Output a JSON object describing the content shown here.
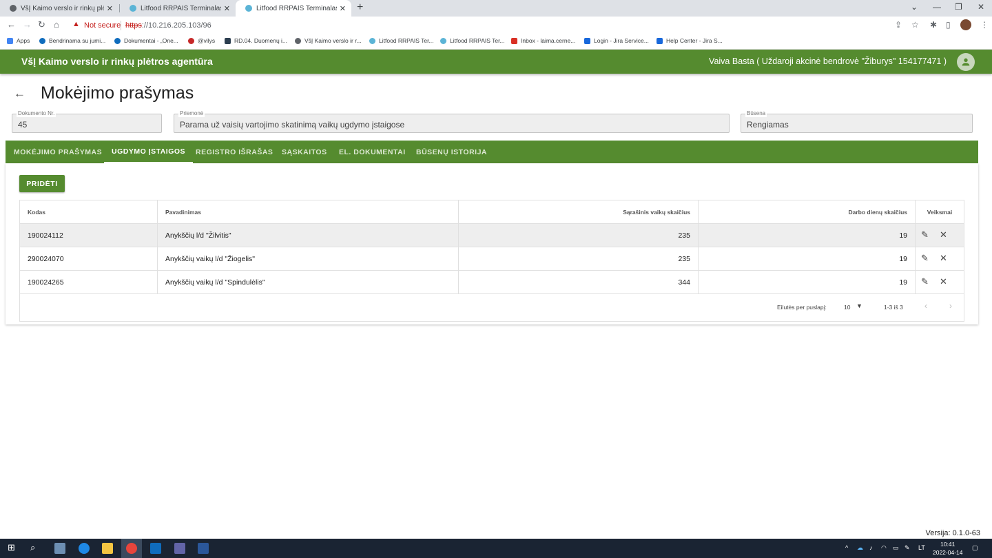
{
  "browser": {
    "tabs": [
      {
        "title": "VšĮ Kaimo verslo ir rinkų plėtros"
      },
      {
        "title": "Litfood RRPAIS Terminalas"
      },
      {
        "title": "Litfood RRPAIS Terminalas"
      }
    ],
    "not_secure": "Not secure",
    "url_proto": "https",
    "url_rest": "://10.216.205.103/96",
    "bookmarks": [
      {
        "label": "Apps"
      },
      {
        "label": "Bendrinama su jumi..."
      },
      {
        "label": "Dokumentai - „One..."
      },
      {
        "label": "@vilys"
      },
      {
        "label": "RD.04. Duomenų i..."
      },
      {
        "label": "VšĮ Kaimo verslo ir r..."
      },
      {
        "label": "Litfood RRPAIS Ter..."
      },
      {
        "label": "Litfood RRPAIS Ter..."
      },
      {
        "label": "Inbox - laima.cerne..."
      },
      {
        "label": "Login - Jira Service..."
      },
      {
        "label": "Help Center - Jira S..."
      }
    ]
  },
  "header": {
    "app_title": "VšĮ Kaimo verslo ir rinkų plėtros agentūra",
    "user": "Vaiva Basta ( Uždaroji akcinė bendrovė \"Žiburys\" 154177471 )"
  },
  "page": {
    "title": "Mokėjimo prašymas",
    "fields": {
      "doc_label": "Dokumento Nr.",
      "doc_value": "45",
      "measure_label": "Priemonė",
      "measure_value": "Parama už vaisių vartojimo skatinimą vaikų ugdymo įstaigose",
      "status_label": "Būsena",
      "status_value": "Rengiamas"
    },
    "tabs": [
      {
        "label": "MOKĖJIMO PRAŠYMAS"
      },
      {
        "label": "UGDYMO ĮSTAIGOS"
      },
      {
        "label": "REGISTRO IŠRAŠAS"
      },
      {
        "label": "SĄSKAITOS"
      },
      {
        "label": "EL. DOKUMENTAI"
      },
      {
        "label": "BŪSENŲ ISTORIJA"
      }
    ],
    "active_tab": "UGDYMO ĮSTAIGOS",
    "add_button": "PRIDĖTI"
  },
  "table": {
    "headers": [
      "Kodas",
      "Pavadinimas",
      "Sąrašinis vaikų skaičius",
      "Darbo dienų skaičius",
      "Veiksmai"
    ],
    "rows": [
      {
        "code": "190024112",
        "name": "Anykščių l/d \"Žilvitis\"",
        "children": "235",
        "days": "19"
      },
      {
        "code": "290024070",
        "name": "Anykščių vaikų l/d \"Žiogelis\"",
        "children": "235",
        "days": "19"
      },
      {
        "code": "190024265",
        "name": "Anykščių vaikų l/d \"Spindulėlis\"",
        "children": "344",
        "days": "19"
      }
    ],
    "pagination": {
      "rows_per_page_label": "Eilutės per puslapį:",
      "rows_per_page": "10",
      "range": "1-3 iš 3"
    }
  },
  "footer": {
    "version": "Versija: 0.1.0-63"
  },
  "taskbar": {
    "lang": "LT",
    "time": "10:41",
    "date": "2022-04-14"
  },
  "colors": {
    "primary": "#558b2f",
    "danger": "#c5221f"
  }
}
